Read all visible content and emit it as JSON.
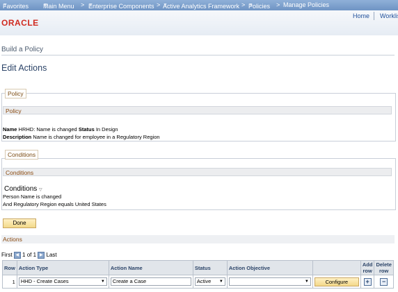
{
  "topnav": {
    "favorites": "Favorites",
    "main_menu": "Main Menu",
    "sep": ">",
    "enterprise": "Enterprise Components",
    "aaf": "Active Analytics Framework",
    "policies": "Policies",
    "manage": "Manage Policies"
  },
  "header": {
    "logo": "ORACLE",
    "home": "Home",
    "worklist": "Worklis"
  },
  "breadcrumb": "Build a Policy",
  "page_title": "Edit Actions",
  "policy": {
    "group_label": "Policy",
    "subheader": "Policy",
    "name_label": "Name",
    "name_value": "HRHD: Name is changed",
    "status_label": "Status",
    "status_value": "In Design",
    "desc_label": "Description",
    "desc_value": "Name is changed for employee in a Regulatory Region"
  },
  "conditions": {
    "group_label": "Conditions",
    "subheader": "Conditions",
    "title": "Conditions",
    "line1": "Person Name is changed",
    "line2": "And Regulatory Region equals United States"
  },
  "done_label": "Done",
  "actions": {
    "header": "Actions",
    "nav": {
      "first": "First",
      "range": "1 of 1",
      "last": "Last"
    },
    "columns": {
      "row": "Row",
      "type": "Action Type",
      "name": "Action Name",
      "status": "Status",
      "objective": "Action Objective",
      "add": "Add row",
      "delete": "Delete row"
    },
    "row1": {
      "num": "1",
      "type": "HHD - Create Cases",
      "name": "Create a Case",
      "status": "Active",
      "objective": "",
      "configure": "Configure"
    }
  },
  "colors": {
    "accent": "#8a4a10",
    "nav_bar": "#7a9cc9",
    "logo": "#d02a20"
  }
}
